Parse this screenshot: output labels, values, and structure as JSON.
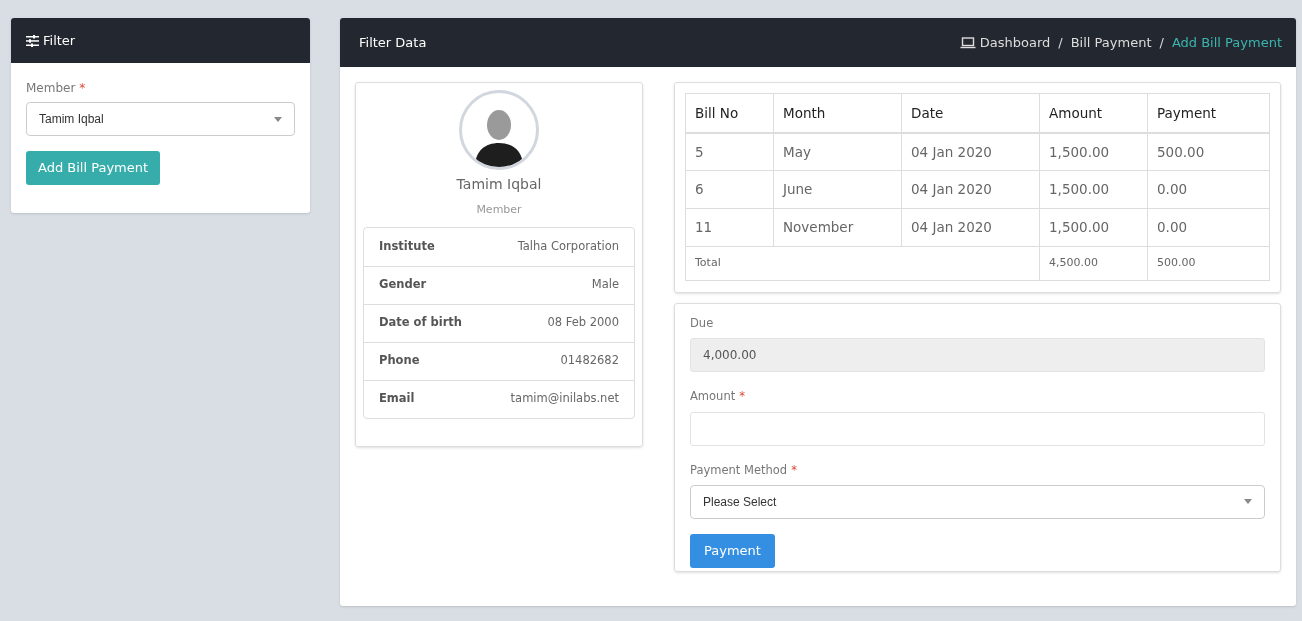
{
  "filter_panel": {
    "title": "Filter",
    "member_field": {
      "label": "Member",
      "required_mark": "*",
      "value": "Tamim Iqbal"
    },
    "button": "Add Bill Payment"
  },
  "main_panel": {
    "title": "Filter Data",
    "breadcrumb": [
      {
        "label": "Dashboard",
        "selected": false,
        "kind": "home"
      },
      {
        "separator": "/",
        "label": "Bill Payment",
        "selected": false,
        "kind": "link"
      },
      {
        "separator": "/",
        "label": "Add Bill Payment",
        "selected": true,
        "kind": "link"
      }
    ]
  },
  "profile": {
    "name": "Tamim Iqbal",
    "role": "Member",
    "details": [
      {
        "label": "Institute",
        "value": "Talha Corporation"
      },
      {
        "label": "Gender",
        "value": "Male"
      },
      {
        "label": "Date of birth",
        "value": "08 Feb 2000"
      },
      {
        "label": "Phone",
        "value": "01482682"
      },
      {
        "label": "Email",
        "value": "tamim@inilabs.net"
      }
    ]
  },
  "table": {
    "columns": [
      "Bill No",
      "Month",
      "Date",
      "Amount",
      "Payment"
    ],
    "rows": [
      [
        "5",
        "May",
        "04 Jan 2020",
        "1,500.00",
        "500.00"
      ],
      [
        "6",
        "June",
        "04 Jan 2020",
        "1,500.00",
        "0.00"
      ],
      [
        "11",
        "November",
        "04 Jan 2020",
        "1,500.00",
        "0.00"
      ]
    ],
    "total": {
      "label": "Total",
      "amount": "4,500.00",
      "payment": "500.00"
    }
  },
  "payment_form": {
    "due": {
      "label": "Due",
      "value": "4,000.00"
    },
    "amount": {
      "label": "Amount",
      "required_mark": "*"
    },
    "method": {
      "label": "Payment Method",
      "required_mark": "*",
      "value": "Please Select"
    },
    "button": "Payment"
  }
}
